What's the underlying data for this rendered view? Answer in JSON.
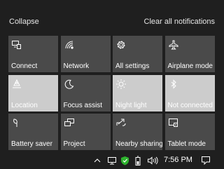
{
  "header": {
    "collapse_label": "Collapse",
    "clear_label": "Clear all notifications"
  },
  "tiles": [
    {
      "label": "Connect",
      "icon": "connect-icon",
      "state": "off"
    },
    {
      "label": "Network",
      "icon": "network-icon",
      "state": "off"
    },
    {
      "label": "All settings",
      "icon": "gear-icon",
      "state": "off"
    },
    {
      "label": "Airplane mode",
      "icon": "airplane-icon",
      "state": "off"
    },
    {
      "label": "Location",
      "icon": "location-icon",
      "state": "on"
    },
    {
      "label": "Focus assist",
      "icon": "moon-icon",
      "state": "off"
    },
    {
      "label": "Night light",
      "icon": "sun-icon",
      "state": "on"
    },
    {
      "label": "Not connected",
      "icon": "bluetooth-icon",
      "state": "on"
    },
    {
      "label": "Battery saver",
      "icon": "battery-saver-icon",
      "state": "off"
    },
    {
      "label": "Project",
      "icon": "project-icon",
      "state": "off"
    },
    {
      "label": "Nearby sharing",
      "icon": "share-icon",
      "state": "off"
    },
    {
      "label": "Tablet mode",
      "icon": "tablet-mode-icon",
      "state": "off"
    }
  ],
  "taskbar": {
    "time": "7:56 PM",
    "icons": [
      "chevron-up-icon",
      "network-status-icon",
      "defender-icon",
      "battery-icon",
      "volume-icon",
      "notification-icon"
    ]
  },
  "colors": {
    "background": "#1f1f1f",
    "tile_off": "#4a4a4a",
    "tile_on": "#cccccc",
    "accent_green": "#2eb32e"
  }
}
